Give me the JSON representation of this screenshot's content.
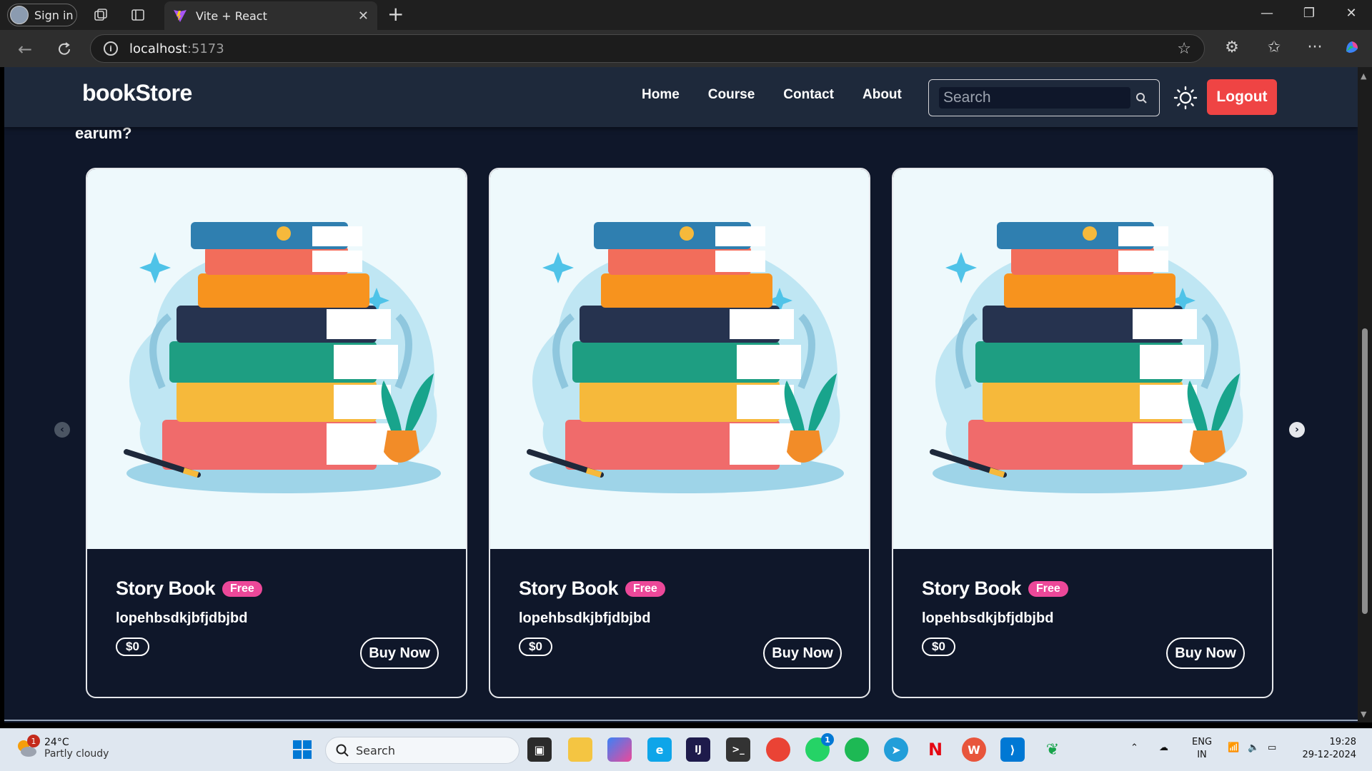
{
  "browser": {
    "profile_label": "Sign in",
    "tab_title": "Vite + React",
    "url_host": "localhost",
    "url_port": ":5173"
  },
  "navbar": {
    "brand": "bookStore",
    "links": [
      "Home",
      "Course",
      "Contact",
      "About"
    ],
    "search_placeholder": "Search",
    "logout_label": "Logout"
  },
  "scrolled_text": "earum?",
  "cards": [
    {
      "title": "Story Book",
      "badge": "Free",
      "description": "lopehbsdkjbfjdbjbd",
      "price": "$0",
      "button": "Buy Now"
    },
    {
      "title": "Story Book",
      "badge": "Free",
      "description": "lopehbsdkjbfjdbjbd",
      "price": "$0",
      "button": "Buy Now"
    },
    {
      "title": "Story Book",
      "badge": "Free",
      "description": "lopehbsdkjbfjdbjbd",
      "price": "$0",
      "button": "Buy Now"
    }
  ],
  "taskbar": {
    "weather_temp": "24°C",
    "weather_condition": "Partly cloudy",
    "weather_badge": "1",
    "search_label": "Search",
    "lang_top": "ENG",
    "lang_bottom": "IN",
    "time": "19:28",
    "date": "29-12-2024",
    "whatsapp_badge": "1"
  },
  "colors": {
    "page_bg": "#0f172a",
    "navbar_bg": "#1e293b",
    "logout_bg": "#ef4444",
    "badge_bg": "#ec4899",
    "card_image_bg": "#eef9fc"
  }
}
